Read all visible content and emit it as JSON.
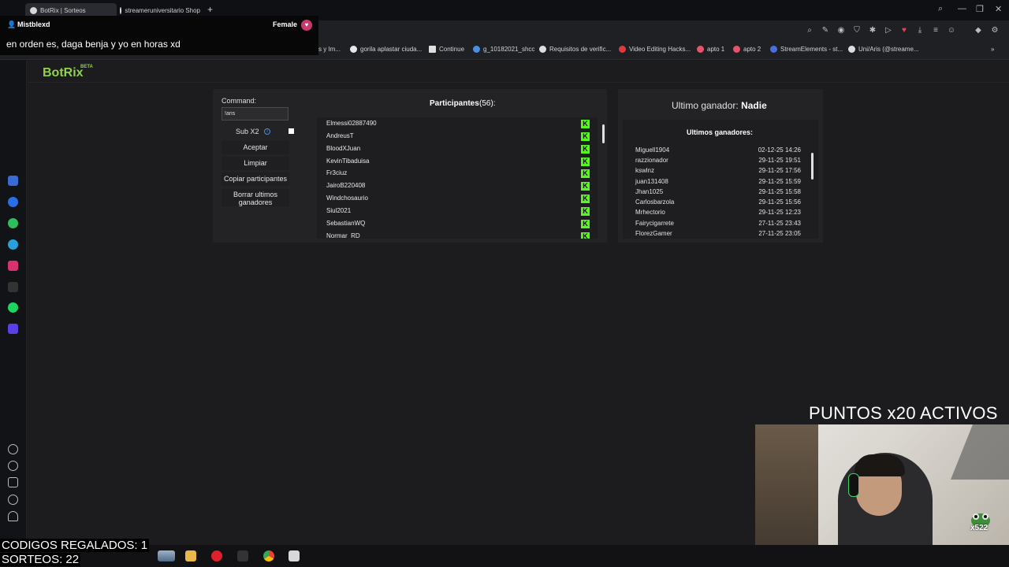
{
  "browser": {
    "tabs": [
      {
        "title": "BotRix | Sorteos",
        "active": true
      },
      {
        "title": "streameruniversitario Shop"
      }
    ],
    "new_tab": "+",
    "bookmarks": [
      {
        "label": "s y Im...",
        "color": "#888888"
      },
      {
        "label": "gorila aplastar ciuda...",
        "color": "#e8e8e8"
      },
      {
        "label": "Continue",
        "color": "#e0e0e0"
      },
      {
        "label": "g_10182021_shcc",
        "color": "#4b8de0"
      },
      {
        "label": "Requisitos de verific...",
        "color": "#dddddd"
      },
      {
        "label": "Video Editing Hacks...",
        "color": "#e03b3b"
      },
      {
        "label": "apto 1",
        "color": "#e2566b"
      },
      {
        "label": "apto 2",
        "color": "#e2566b"
      },
      {
        "label": "StreamElements - st...",
        "color": "#4b6de0"
      },
      {
        "label": "Uni/Aris (@streame...",
        "color": "#dddddd"
      }
    ]
  },
  "chat": {
    "username": "Mistblexd",
    "gender": "Female",
    "message": "en orden es, daga benja y yo en horas xd"
  },
  "botrix": {
    "logo": "BotRix",
    "logo_tag": "BETA",
    "command_label": "Command:",
    "command_value": "!aris",
    "sub_label": "Sub X2",
    "buttons": {
      "accept": "Aceptar",
      "clear": "Limpiar",
      "copy": "Copiar participantes",
      "delete_last": "Borrar ultimos ganadores"
    },
    "participants_title": "Participantes",
    "participants_count": "(56):",
    "participants": [
      "Elmessi02887490",
      "AndreusT",
      "BloodXJuan",
      "KevinTibaduisa",
      "Fr3ciuz",
      "JairoB220408",
      "Windchosaurio",
      "Siul2021",
      "SebastianWQ",
      "Normar_RD"
    ],
    "last_winner_label": "Ultimo ganador:",
    "last_winner_value": "Nadie",
    "winners_title": "Ultimos ganadores:",
    "winners": [
      {
        "name": "Miguell1904",
        "date": "02-12-25 14:26"
      },
      {
        "name": "razzionador",
        "date": "29-11-25 19:51"
      },
      {
        "name": "kswlnz",
        "date": "29-11-25 17:56"
      },
      {
        "name": "juan131408",
        "date": "29-11-25 15:59"
      },
      {
        "name": "Jhan1025",
        "date": "29-11-25 15:58"
      },
      {
        "name": "Carlosbarzola",
        "date": "29-11-25 15:56"
      },
      {
        "name": "Mrhectorio",
        "date": "29-11-25 12:23"
      },
      {
        "name": "Fairycigarrete",
        "date": "27-11-25 23:43"
      },
      {
        "name": "FlorezGamer",
        "date": "27-11-25 23:05"
      }
    ]
  },
  "stream": {
    "points_banner": "PUNTOS x20 ACTIVOS",
    "codes": "CODIGOS REGALADOS: 1",
    "draws": "SORTEOS: 22",
    "multiplier_badge": "x522"
  },
  "colors": {
    "kick_green": "#53fc18",
    "botrix_green": "#8fd24a",
    "gender_badge": "#c9396f"
  }
}
